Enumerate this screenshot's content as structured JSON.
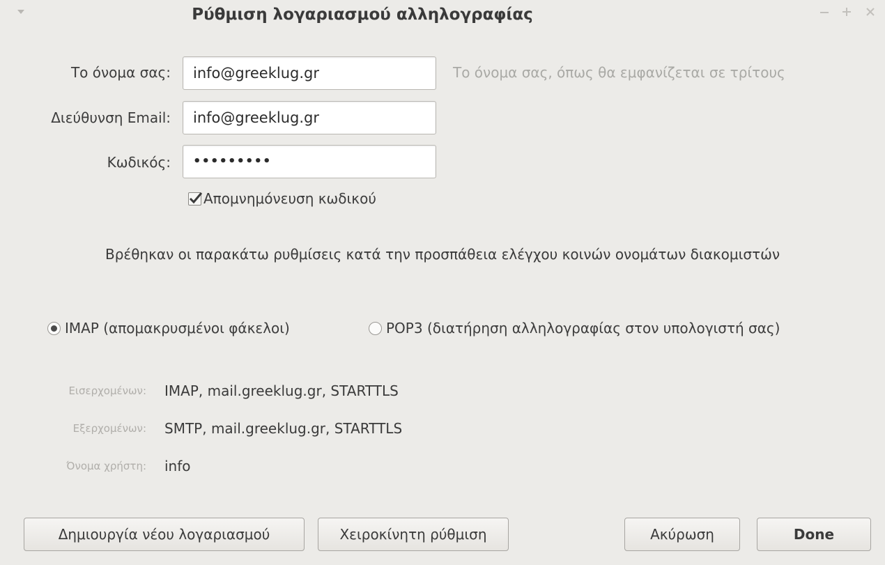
{
  "window": {
    "title": "Ρύθμιση λογαριασμού αλληλογραφίας"
  },
  "form": {
    "name_label": "Το όνομα σας:",
    "name_value": "info@greeklug.gr",
    "name_hint": "Το όνομα σας, όπως θα εμφανίζεται σε τρίτους",
    "email_label": "Διεύθυνση Email:",
    "email_value": "info@greeklug.gr",
    "password_label": "Κωδικός:",
    "password_dots": "•••••••••",
    "remember_label": "Απομνημόνευση κωδικού",
    "remember_checked": true
  },
  "notice": "Βρέθηκαν οι παρακάτω ρυθμίσεις κατά την προσπάθεια ελέγχου κοινών ονομάτων διακομιστών",
  "protocol": {
    "imap_label": "IMAP (απομακρυσμένοι φάκελοι)",
    "pop3_label": "POP3 (διατήρηση αλληλογραφίας στον υπολογιστή σας)",
    "selected": "IMAP"
  },
  "servers": {
    "incoming_label": "Εισερχομένων:",
    "incoming_value": "IMAP, mail.greeklug.gr, STARTTLS",
    "outgoing_label": "Εξερχομένων:",
    "outgoing_value": "SMTP, mail.greeklug.gr, STARTTLS",
    "username_label": "Όνομα χρήστη:",
    "username_value": "info"
  },
  "buttons": {
    "new_account": "Δημιουργία νέου λογαριασμού",
    "manual_config": "Χειροκίνητη ρύθμιση",
    "cancel": "Ακύρωση",
    "done": "Done"
  }
}
